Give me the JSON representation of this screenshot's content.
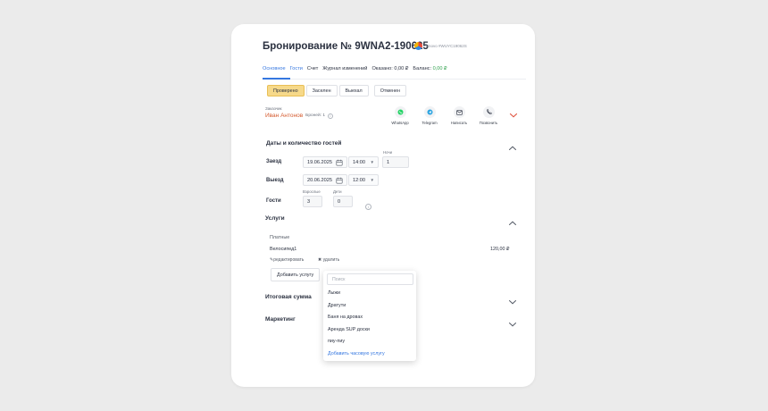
{
  "booking": {
    "title": "Бронирование № 9WNA2-190625",
    "source": "Bnovo #WUYC19062S"
  },
  "tabs": {
    "items": [
      "Основное",
      "Гости",
      "Счет",
      "Журнал изменений"
    ],
    "paid_label": "Оказано: 0,00 ₽",
    "balance_label": "Баланс:",
    "balance_value": "0,00 ₽"
  },
  "status": {
    "buttons": [
      "Проверено",
      "Заселен",
      "Выехал",
      "Отменен"
    ],
    "active": "Проверено"
  },
  "client": {
    "label": "Заказчик",
    "name": "Иван Антонов",
    "bookings": "Броней: 1"
  },
  "contacts": {
    "items": [
      {
        "label": "WhatsApp",
        "icon": "whatsapp-icon",
        "color": "#25d366"
      },
      {
        "label": "Telegram",
        "icon": "telegram-icon",
        "color": "#2aa3e0"
      },
      {
        "label": "Написать",
        "icon": "mail-icon",
        "color": "#2b3140"
      },
      {
        "label": "Позвонить",
        "icon": "phone-icon",
        "color": "#2b3140"
      }
    ]
  },
  "dates": {
    "section_title": "Даты и количество гостей",
    "checkin_label": "Заезд",
    "checkin_date": "19.06.2025",
    "checkin_time": "14:00",
    "nights_label": "Ночи",
    "nights_value": "1",
    "checkout_label": "Выезд",
    "checkout_date": "20.06.2025",
    "checkout_time": "12:00",
    "guests_label": "Гости",
    "adults_label": "Взрослые",
    "adults_value": "3",
    "children_label": "Дети",
    "children_value": "0"
  },
  "services": {
    "section_title": "Услуги",
    "paid_label": "Платные",
    "item_name": "Велосипед1",
    "item_price": "120,00 ₽",
    "edit_label": "редактировать",
    "delete_label": "удалить",
    "add_button": "Добавить услугу"
  },
  "dropdown": {
    "search_placeholder": "Поиск",
    "items": [
      "Лыжи",
      "Дратути",
      "Баня на дровах",
      "Аренда SUP доски",
      "пиу-пиу"
    ],
    "add_hourly": "Добавить часовую услугу"
  },
  "sections": {
    "total_title": "Итоговая сумма",
    "marketing_title": "Маркетинг"
  },
  "colors": {
    "accent": "#3577e0",
    "client_name": "#d55b2f",
    "active_status": "#f6d98a",
    "positive": "#32a24f",
    "collapse_red": "#e0533f"
  }
}
